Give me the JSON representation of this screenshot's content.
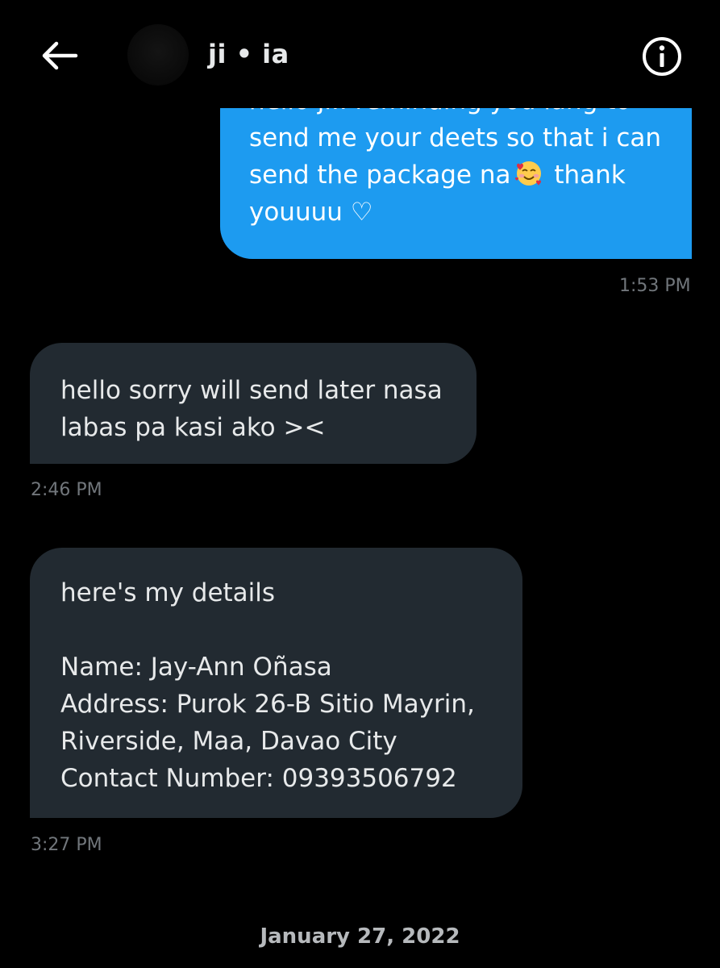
{
  "header": {
    "contact_name": "ji • ia"
  },
  "messages": [
    {
      "direction": "sent",
      "partial_line": "hello ji.. reminding you lang to",
      "text_before_emoji": "send me your deets so that i can\nsend the package na",
      "emoji": "smiling-face-with-hearts-icon",
      "text_after_emoji": " thank\nyouuuu ♡",
      "time": "1:53 PM"
    },
    {
      "direction": "received",
      "text": "hello sorry will send later nasa\nlabas pa kasi ako ><",
      "time": "2:46 PM"
    },
    {
      "direction": "received",
      "text": "here's my details\n\nName: Jay-Ann Oñasa\nAddress: Purok 26-B Sitio Mayrin,\nRiverside, Maa, Davao City\nContact Number: 09393506792",
      "time": "3:27 PM"
    }
  ],
  "date_separator": "January 27, 2022",
  "colors": {
    "background": "#000000",
    "sent_bubble": "#1d9bf0",
    "received_bubble": "#222a31",
    "timestamp": "#71767b"
  }
}
